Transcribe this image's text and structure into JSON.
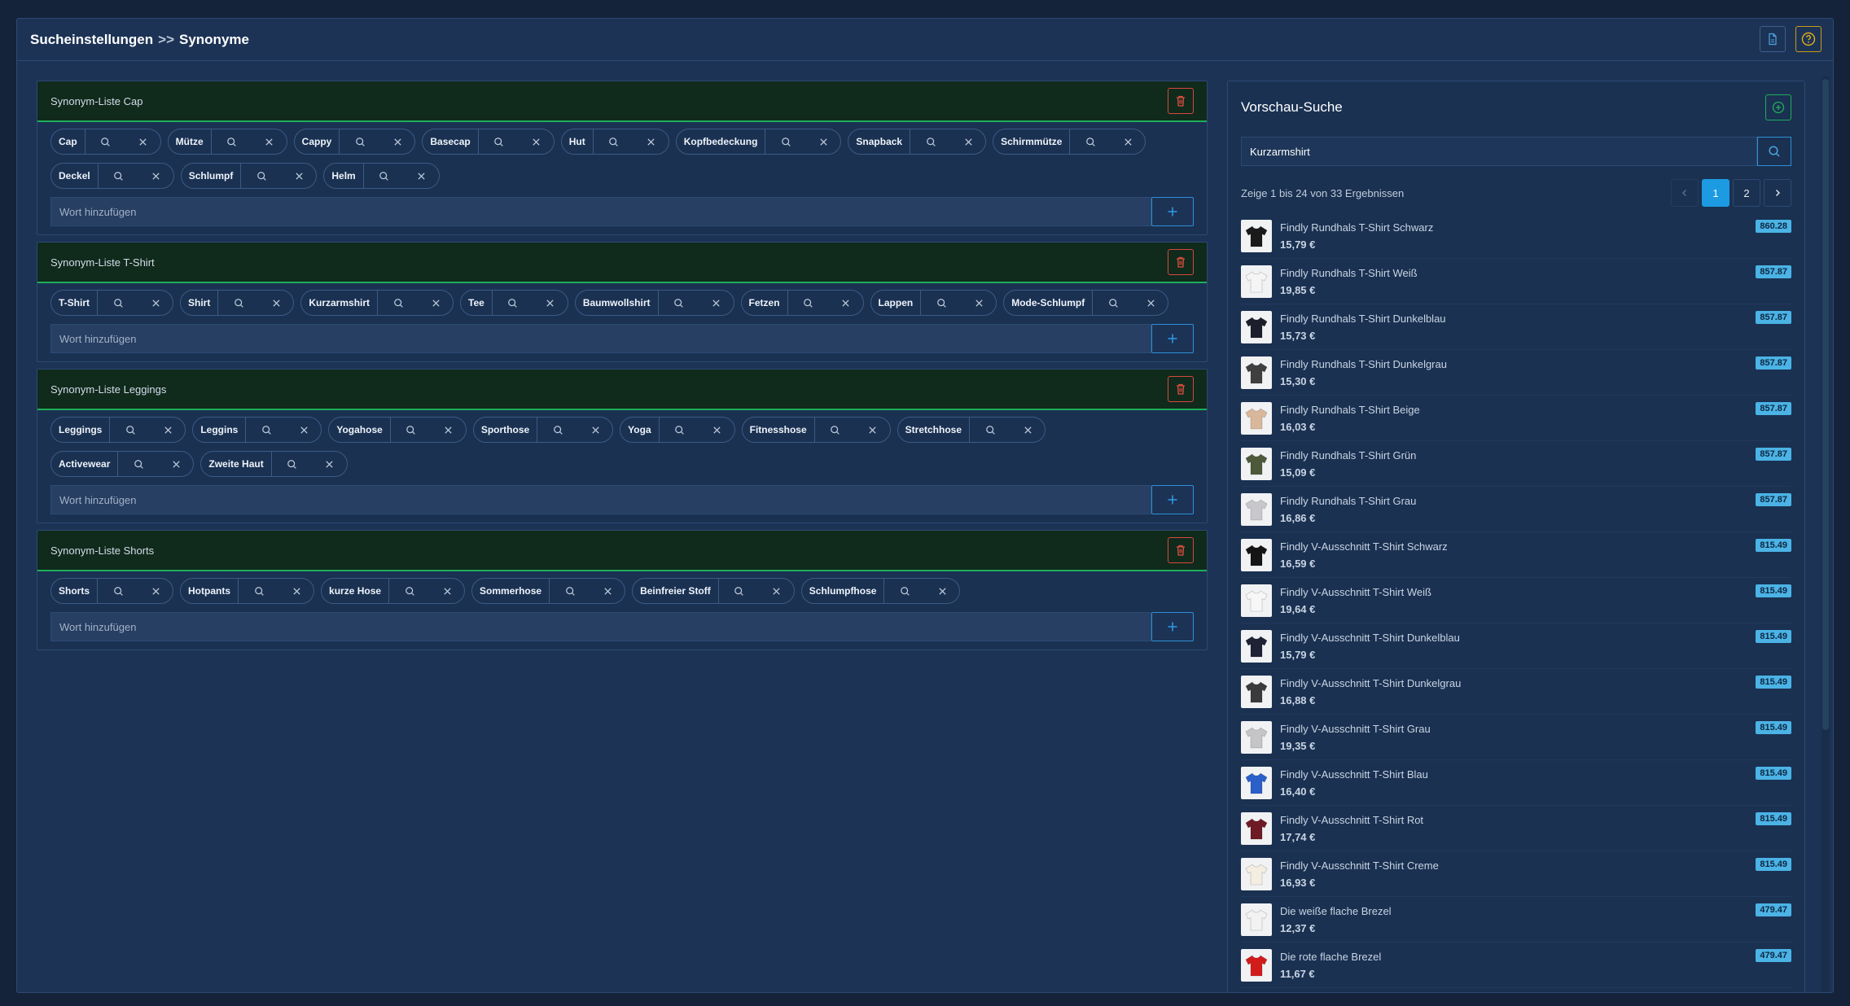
{
  "breadcrumb": {
    "parent": "Sucheinstellungen",
    "separator": ">>",
    "current": "Synonyme"
  },
  "colors": {
    "accent": "#1c9be2",
    "delete": "#d64a3d",
    "success": "#1fae5a",
    "help": "#c99a16"
  },
  "synonym_lists": [
    {
      "title": "Synonym-Liste Cap",
      "words": [
        "Cap",
        "Mütze",
        "Cappy",
        "Basecap",
        "Hut",
        "Kopfbedeckung",
        "Snapback",
        "Schirmmütze",
        "Deckel",
        "Schlumpf",
        "Helm"
      ],
      "add_placeholder": "Wort hinzufügen"
    },
    {
      "title": "Synonym-Liste T-Shirt",
      "words": [
        "T-Shirt",
        "Shirt",
        "Kurzarmshirt",
        "Tee",
        "Baumwollshirt",
        "Fetzen",
        "Lappen",
        "Mode-Schlumpf"
      ],
      "add_placeholder": "Wort hinzufügen"
    },
    {
      "title": "Synonym-Liste Leggings",
      "words": [
        "Leggings",
        "Leggins",
        "Yogahose",
        "Sporthose",
        "Yoga",
        "Fitnesshose",
        "Stretchhose",
        "Activewear",
        "Zweite Haut"
      ],
      "add_placeholder": "Wort hinzufügen"
    },
    {
      "title": "Synonym-Liste Shorts",
      "words": [
        "Shorts",
        "Hotpants",
        "kurze Hose",
        "Sommerhose",
        "Beinfreier Stoff",
        "Schlumpfhose"
      ],
      "add_placeholder": "Wort hinzufügen"
    }
  ],
  "preview": {
    "title": "Vorschau-Suche",
    "search_value": "Kurzarmshirt",
    "result_text": "Zeige 1 bis 24 von 33 Ergebnissen",
    "pages": [
      "1",
      "2"
    ],
    "active_page": "1",
    "results": [
      {
        "name": "Findly Rundhals T-Shirt Schwarz",
        "price": "15,79 €",
        "score": "860.28",
        "color": "#1a1a1a"
      },
      {
        "name": "Findly Rundhals T-Shirt Weiß",
        "price": "19,85 €",
        "score": "857.87",
        "color": "#f5f5f5"
      },
      {
        "name": "Findly Rundhals T-Shirt Dunkelblau",
        "price": "15,73 €",
        "score": "857.87",
        "color": "#1c1f2b"
      },
      {
        "name": "Findly Rundhals T-Shirt Dunkelgrau",
        "price": "15,30 €",
        "score": "857.87",
        "color": "#3f3f3f"
      },
      {
        "name": "Findly Rundhals T-Shirt Beige",
        "price": "16,03 €",
        "score": "857.87",
        "color": "#d9b79a"
      },
      {
        "name": "Findly Rundhals T-Shirt Grün",
        "price": "15,09 €",
        "score": "857.87",
        "color": "#4d5a3a"
      },
      {
        "name": "Findly Rundhals T-Shirt Grau",
        "price": "16,86 €",
        "score": "857.87",
        "color": "#c8c8cc"
      },
      {
        "name": "Findly V-Ausschnitt T-Shirt Schwarz",
        "price": "16,59 €",
        "score": "815.49",
        "color": "#151515"
      },
      {
        "name": "Findly V-Ausschnitt T-Shirt Weiß",
        "price": "19,64 €",
        "score": "815.49",
        "color": "#f7f7f7"
      },
      {
        "name": "Findly V-Ausschnitt T-Shirt Dunkelblau",
        "price": "15,79 €",
        "score": "815.49",
        "color": "#1e2235"
      },
      {
        "name": "Findly V-Ausschnitt T-Shirt Dunkelgrau",
        "price": "16,88 €",
        "score": "815.49",
        "color": "#3a3a3c"
      },
      {
        "name": "Findly V-Ausschnitt T-Shirt Grau",
        "price": "19,35 €",
        "score": "815.49",
        "color": "#c5c5c8"
      },
      {
        "name": "Findly V-Ausschnitt T-Shirt Blau",
        "price": "16,40 €",
        "score": "815.49",
        "color": "#2b5fc9"
      },
      {
        "name": "Findly V-Ausschnitt T-Shirt Rot",
        "price": "17,74 €",
        "score": "815.49",
        "color": "#6e1b25"
      },
      {
        "name": "Findly V-Ausschnitt T-Shirt Creme",
        "price": "16,93 €",
        "score": "815.49",
        "color": "#f4ede2"
      },
      {
        "name": "Die weiße flache Brezel",
        "price": "12,37 €",
        "score": "479.47",
        "color": "#f2f2f2"
      },
      {
        "name": "Die rote flache Brezel",
        "price": "11,67 €",
        "score": "479.47",
        "color": "#d21c1c"
      }
    ]
  }
}
